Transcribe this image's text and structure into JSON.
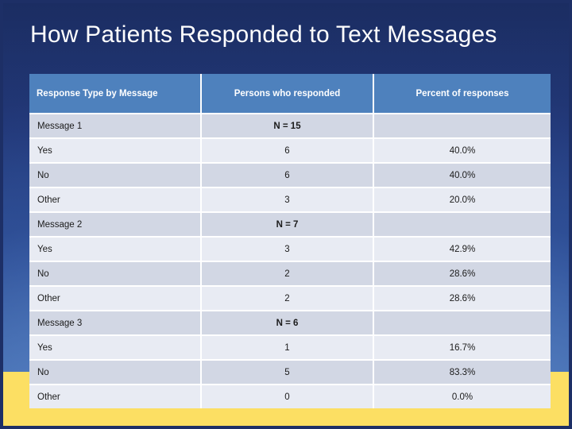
{
  "slide": {
    "title": "How Patients Responded to Text Messages",
    "colors": {
      "background_top": "#1b2d62",
      "background_bottom": "#4f7ebd",
      "footer_band": "#fcdf63",
      "header_row": "#4e81bd",
      "row_dark": "#d2d7e4",
      "row_light": "#e8ebf3",
      "title_text": "#ffffff"
    }
  },
  "table": {
    "columns": [
      "Response Type by Message",
      "Persons who responded",
      "Percent of responses"
    ],
    "rows": [
      {
        "label": "Message 1",
        "indent": false,
        "group": true,
        "shade": "dark",
        "persons": "N = 15",
        "percent": ""
      },
      {
        "label": "Yes",
        "indent": true,
        "group": false,
        "shade": "light",
        "persons": "6",
        "percent": "40.0%"
      },
      {
        "label": "No",
        "indent": true,
        "group": false,
        "shade": "dark",
        "persons": "6",
        "percent": "40.0%"
      },
      {
        "label": "Other",
        "indent": true,
        "group": false,
        "shade": "light",
        "persons": "3",
        "percent": "20.0%"
      },
      {
        "label": "Message 2",
        "indent": false,
        "group": true,
        "shade": "dark",
        "persons": "N = 7",
        "percent": ""
      },
      {
        "label": "Yes",
        "indent": true,
        "group": false,
        "shade": "light",
        "persons": "3",
        "percent": "42.9%"
      },
      {
        "label": "No",
        "indent": true,
        "group": false,
        "shade": "dark",
        "persons": "2",
        "percent": "28.6%"
      },
      {
        "label": "Other",
        "indent": true,
        "group": false,
        "shade": "light",
        "persons": "2",
        "percent": "28.6%"
      },
      {
        "label": "Message 3",
        "indent": false,
        "group": true,
        "shade": "dark",
        "persons": "N = 6",
        "percent": ""
      },
      {
        "label": "Yes",
        "indent": true,
        "group": false,
        "shade": "light",
        "persons": "1",
        "percent": "16.7%"
      },
      {
        "label": "No",
        "indent": true,
        "group": false,
        "shade": "dark",
        "persons": "5",
        "percent": "83.3%"
      },
      {
        "label": "Other",
        "indent": true,
        "group": false,
        "shade": "light",
        "persons": "0",
        "percent": "0.0%"
      }
    ]
  },
  "chart_data": {
    "type": "table",
    "title": "How Patients Responded to Text Messages",
    "columns": [
      "Response Type by Message",
      "Persons who responded",
      "Percent of responses"
    ],
    "groups": [
      {
        "name": "Message 1",
        "n": 15,
        "categories": [
          "Yes",
          "No",
          "Other"
        ],
        "counts": [
          6,
          6,
          3
        ],
        "percents": [
          40.0,
          40.0,
          20.0
        ]
      },
      {
        "name": "Message 2",
        "n": 7,
        "categories": [
          "Yes",
          "No",
          "Other"
        ],
        "counts": [
          3,
          2,
          2
        ],
        "percents": [
          42.9,
          28.6,
          28.6
        ]
      },
      {
        "name": "Message 3",
        "n": 6,
        "categories": [
          "Yes",
          "No",
          "Other"
        ],
        "counts": [
          1,
          5,
          0
        ],
        "percents": [
          16.7,
          83.3,
          0.0
        ]
      }
    ]
  }
}
